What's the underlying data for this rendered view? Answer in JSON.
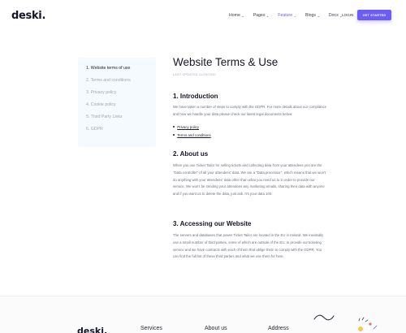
{
  "header": {
    "logo": "deski.",
    "nav": [
      {
        "label": "Home",
        "has_dropdown": true,
        "active": false
      },
      {
        "label": "Pages",
        "has_dropdown": true,
        "active": false
      },
      {
        "label": "Feature",
        "has_dropdown": true,
        "active": true
      },
      {
        "label": "Blogs",
        "has_dropdown": true,
        "active": false
      },
      {
        "label": "Docs",
        "has_dropdown": true,
        "active": false
      }
    ],
    "login_label": "LOGIN",
    "cta_label": "GET STARTED"
  },
  "sidebar": {
    "items": [
      {
        "label": "1. Website terms of use",
        "active": true
      },
      {
        "label": "2. Terms and conditions",
        "active": false
      },
      {
        "label": "3. Privacy policy",
        "active": false
      },
      {
        "label": "4. Cookie policy",
        "active": false
      },
      {
        "label": "5. Third Party Links",
        "active": false
      },
      {
        "label": "6. GDPR",
        "active": false
      }
    ]
  },
  "main": {
    "title": "Website Terms & Use",
    "updated": "LAST UPDATED 11/29/2020",
    "sections": [
      {
        "heading": "1. Introduction",
        "body": "We have taken a number of steps to comply with the GDPR. For more details about our compliance and how we handle your data please check our latest legal documents below:",
        "links": [
          "Privacy policy",
          "Terms and conditions"
        ]
      },
      {
        "heading": "2. About us",
        "body": "When you use Ticket Tailor for selling tickets and collecting data from your attendees you are the \"Data controller\" of all your attendees' data. We are a \"Data processor\", which means that we won't do anything with your attendees' data other than what you need us to in order to provide our service. We won't be sending your attendees any marketing emails, sharing their data with anyone and if you want us to delete the data, just ask. It's your data 100."
      },
      {
        "heading": "3. Accessing our Website",
        "body": "The servers and databases that power Ticket Tailor are located in the EU in Ireland. We inevitably use a small number of third parties, some of which are outside of the EU, to provide our ticketing service and we have contracts with each of them that oblige them to comply with the GDPR. You can find the full list of these third parties and what we use them for here."
      }
    ]
  },
  "footer": {
    "logo": "deski.",
    "columns": [
      "Services",
      "About us",
      "Address"
    ]
  },
  "colors": {
    "accent": "#6c5cf9",
    "sidebar_bg": "#f4fafe",
    "heading": "#15152a",
    "body_text": "#6c7080"
  }
}
